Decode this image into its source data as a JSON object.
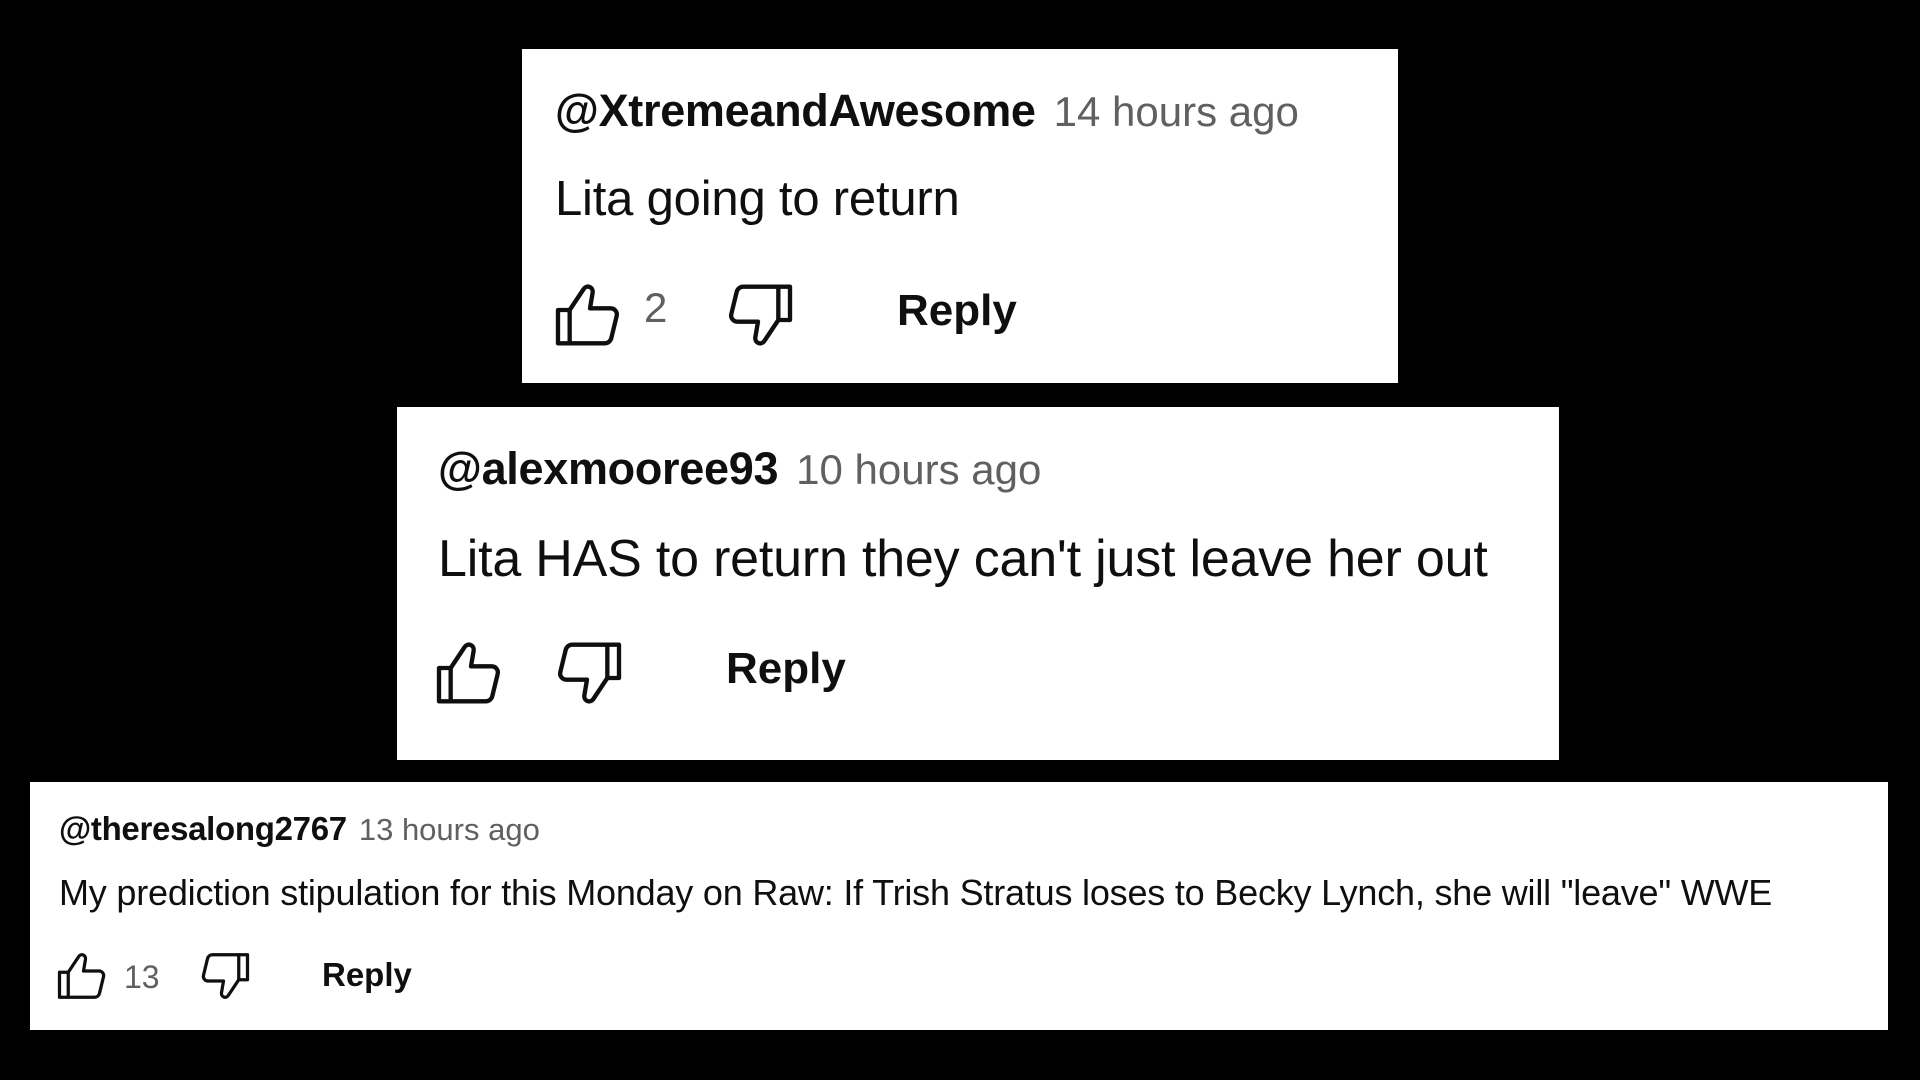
{
  "comments": [
    {
      "handle": "@XtremeandAwesome",
      "time": "14 hours ago",
      "text": "Lita going to return",
      "likes": "2",
      "reply_label": "Reply"
    },
    {
      "handle": "@alexmooree93",
      "time": "10 hours ago",
      "text": "Lita HAS to return they can't just leave her out",
      "likes": "",
      "reply_label": "Reply"
    },
    {
      "handle": "@theresalong2767",
      "time": "13 hours ago",
      "text": "My prediction stipulation for this Monday on Raw: If Trish Stratus loses to Becky Lynch, she will \"leave\" WWE",
      "likes": "13",
      "reply_label": "Reply"
    }
  ],
  "icons": {
    "like": "thumbs-up-icon",
    "dislike": "thumbs-down-icon"
  },
  "colors": {
    "background": "#000000",
    "card": "#ffffff",
    "text": "#0f0f0f",
    "secondary": "#606060"
  }
}
